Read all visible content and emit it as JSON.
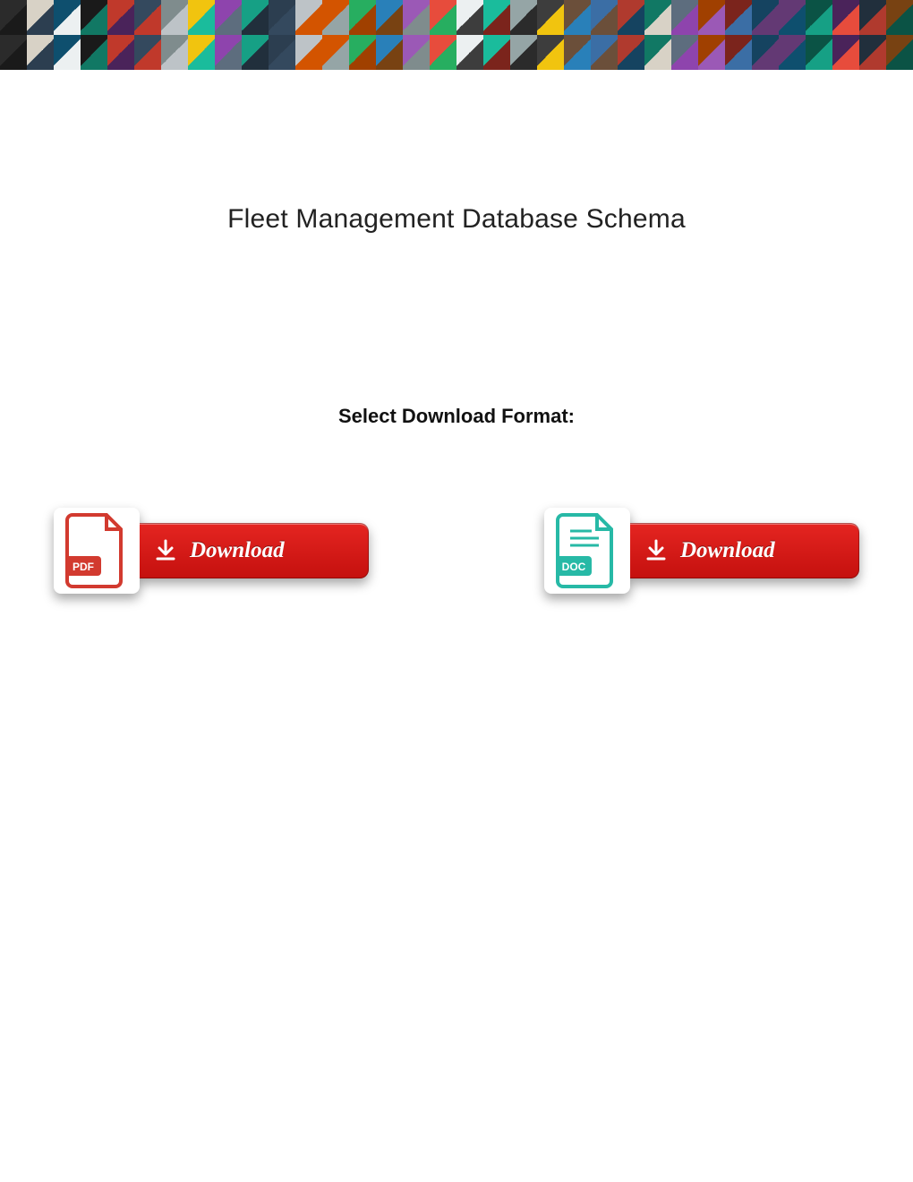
{
  "title": "Fleet Management Database Schema",
  "select_label": "Select Download Format:",
  "buttons": {
    "pdf": {
      "icon_label": "PDF",
      "label": "Download"
    },
    "doc": {
      "icon_label": "DOC",
      "label": "Download"
    }
  },
  "banner_colors": [
    "#2b2b2b",
    "#d8d2c6",
    "#0e4f6e",
    "#1a1a1a",
    "#c0392b",
    "#34495e",
    "#7f8c8d",
    "#f1c40f",
    "#8e44ad",
    "#16a085",
    "#2c3e50",
    "#bdc3c7",
    "#d35400",
    "#27ae60",
    "#2980b9",
    "#9b59b6",
    "#e74c3c",
    "#ecf0f1",
    "#1abc9c",
    "#95a5a6",
    "#3d3d3d",
    "#6b4f3a",
    "#3b6ea5",
    "#b03a2e",
    "#117864",
    "#5d6d7e",
    "#a04000",
    "#7b241c",
    "#154360",
    "#633974",
    "#0b5345",
    "#4a235a",
    "#212f3c",
    "#784212"
  ]
}
